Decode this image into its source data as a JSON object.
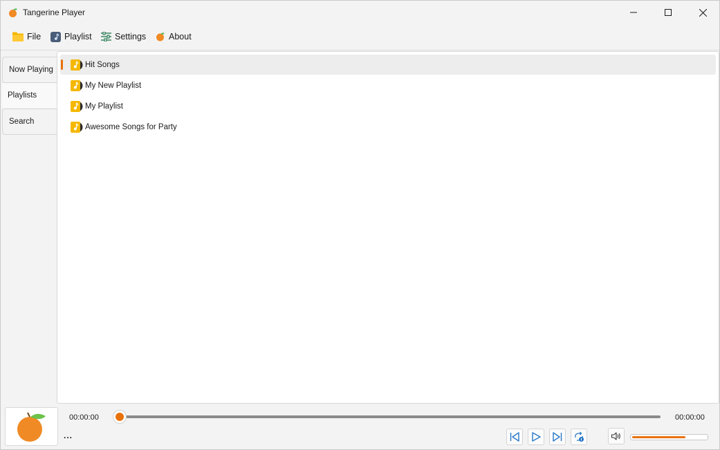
{
  "window": {
    "title": "Tangerine Player",
    "icon": "tangerine-icon"
  },
  "menu": {
    "items": [
      {
        "label": "File",
        "icon": "folder-icon"
      },
      {
        "label": "Playlist",
        "icon": "music-note-icon"
      },
      {
        "label": "Settings",
        "icon": "sliders-icon"
      },
      {
        "label": "About",
        "icon": "tangerine-icon"
      }
    ]
  },
  "tabs": [
    {
      "label": "Now Playing",
      "active": false
    },
    {
      "label": "Playlists",
      "active": true
    },
    {
      "label": "Search",
      "active": false
    }
  ],
  "playlists": [
    {
      "name": "Hit Songs",
      "selected": true,
      "icon": "playlist-disc-icon"
    },
    {
      "name": "My New Playlist",
      "selected": false,
      "icon": "playlist-disc-icon"
    },
    {
      "name": "My Playlist",
      "selected": false,
      "icon": "playlist-disc-icon"
    },
    {
      "name": "Awesome Songs for Party",
      "selected": false,
      "icon": "playlist-disc-icon"
    }
  ],
  "player": {
    "current_time": "00:00:00",
    "total_time": "00:00:00",
    "song_title": "...",
    "seek_progress": 0,
    "volume_level": 0.72,
    "buttons": [
      "previous",
      "play",
      "next",
      "repeat-one",
      "volume"
    ]
  },
  "colors": {
    "accent": "#e8710a",
    "folder": "#f5b800",
    "playlist_icon": "#f5b800"
  }
}
